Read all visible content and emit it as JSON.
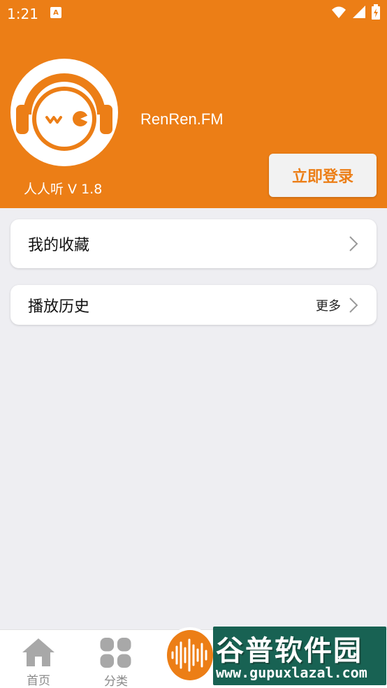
{
  "status_bar": {
    "time": "1:21",
    "notification_icon": "a-letter-icon"
  },
  "profile": {
    "site_name": "RenRen.FM",
    "version": "人人听 V 1.8",
    "login_label": "立即登录"
  },
  "menu": {
    "favorites_label": "我的收藏",
    "history_label": "播放历史",
    "history_more": "更多"
  },
  "bottom_nav": {
    "home_label": "首页",
    "category_label": "分类"
  },
  "watermark": {
    "title": "谷普软件园",
    "url": "www.gupuxlazal.com"
  },
  "colors": {
    "accent": "#EC7E16",
    "background": "#EEEEF2",
    "watermark": "#0c5a4a"
  }
}
